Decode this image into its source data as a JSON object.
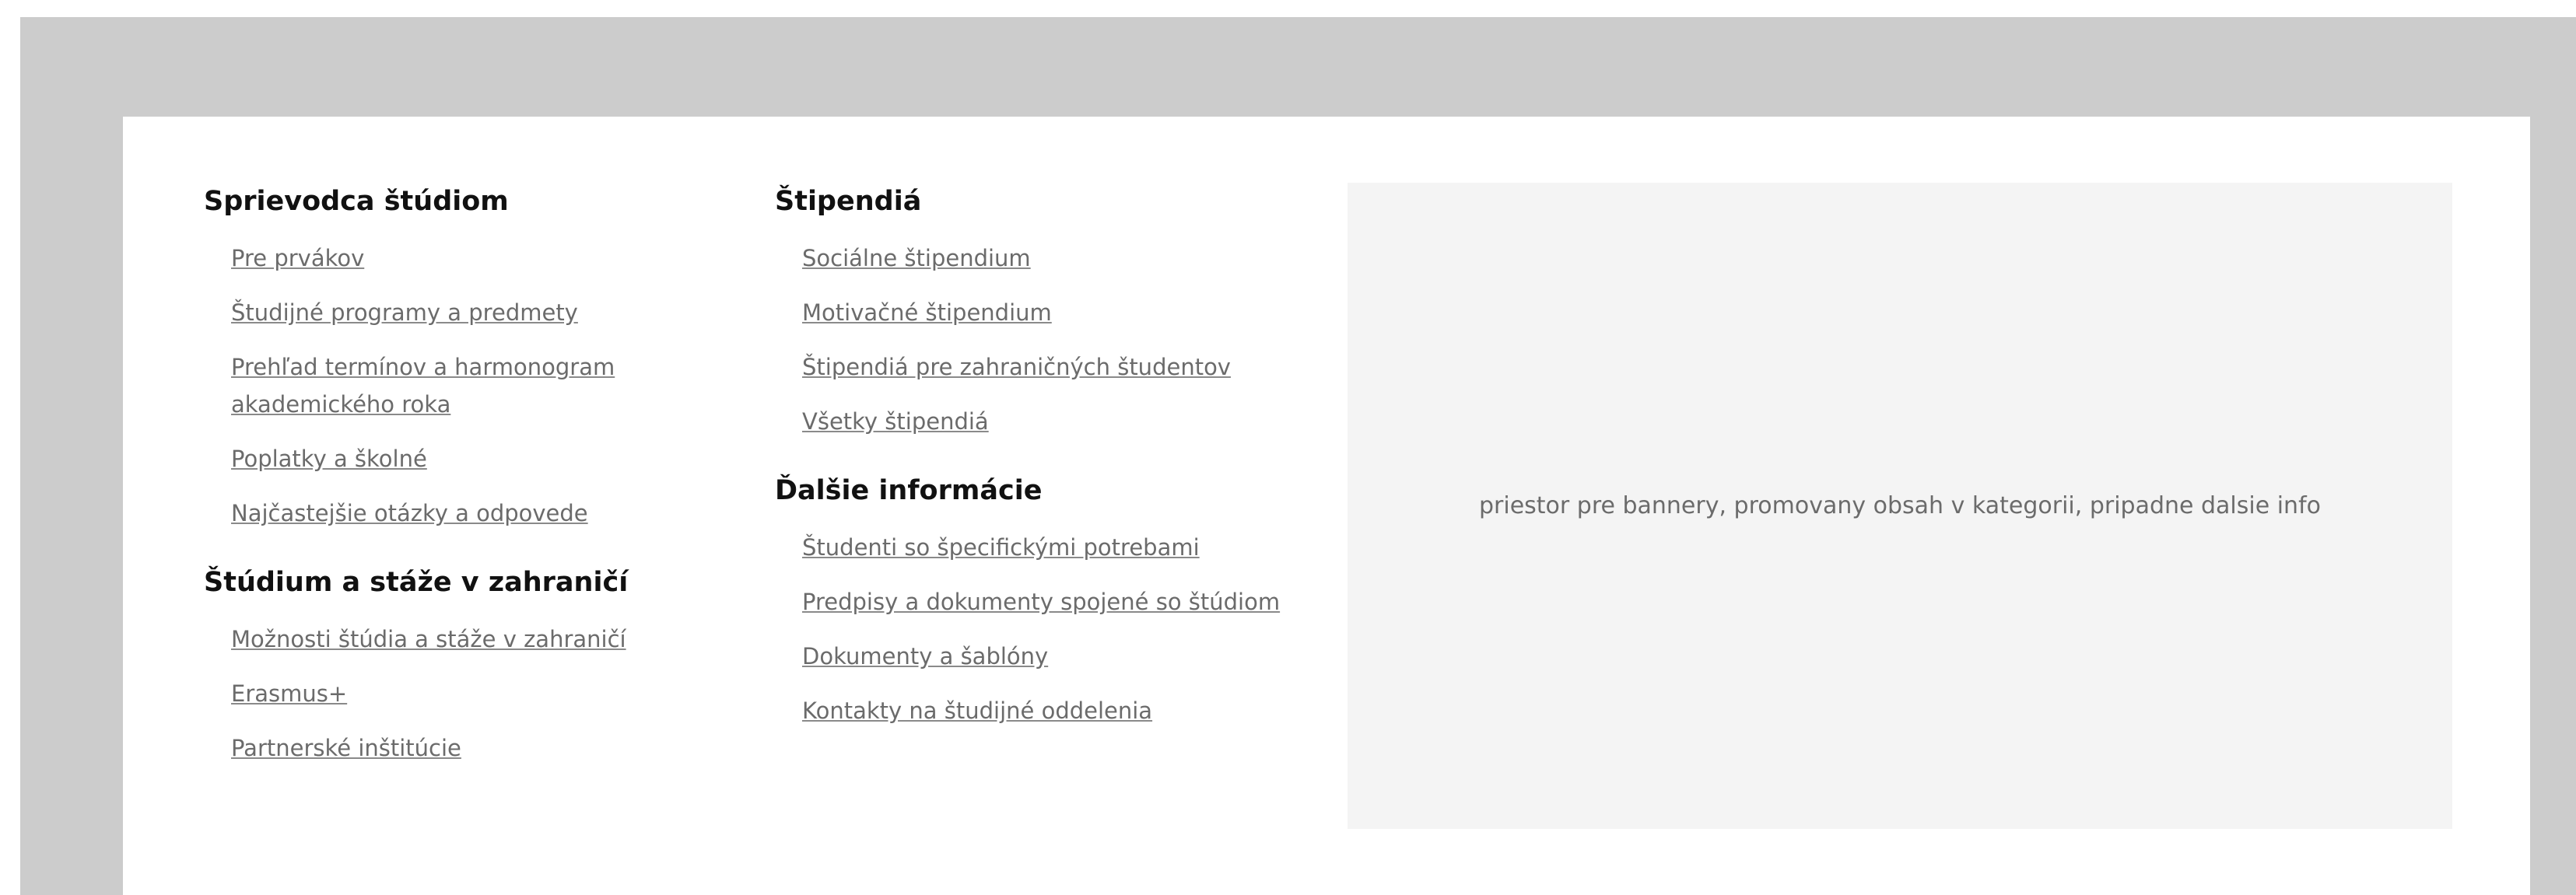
{
  "colors": {
    "frame": "#cccccc",
    "panel": "#ffffff",
    "banner_bg": "#f4f4f4",
    "link": "#6b6b6b",
    "heading": "#111111"
  },
  "column1": {
    "section1": {
      "title": "Sprievodca štúdiom",
      "links": [
        "Pre prvákov",
        "Študijné programy a predmety",
        "Prehľad termínov a harmonogram akademického roka",
        "Poplatky a školné",
        "Najčastejšie otázky a odpovede"
      ]
    },
    "section2": {
      "title": "Štúdium a stáže v zahraničí",
      "links": [
        "Možnosti štúdia a stáže v zahraničí",
        "Erasmus+",
        "Partnerské inštitúcie"
      ]
    }
  },
  "column2": {
    "section1": {
      "title": "Štipendiá",
      "links": [
        "Sociálne štipendium",
        "Motivačné štipendium",
        "Štipendiá pre zahraničných študentov",
        "Všetky štipendiá"
      ]
    },
    "section2": {
      "title": "Ďalšie informácie",
      "links": [
        "Študenti so špecifickými potrebami",
        "Predpisy a dokumenty spojené so štúdiom",
        "Dokumenty a šablóny",
        "Kontakty na študijné oddelenia"
      ]
    }
  },
  "banner": {
    "text": "priestor pre bannery, promovany obsah v kategorii, pripadne dalsie info"
  }
}
